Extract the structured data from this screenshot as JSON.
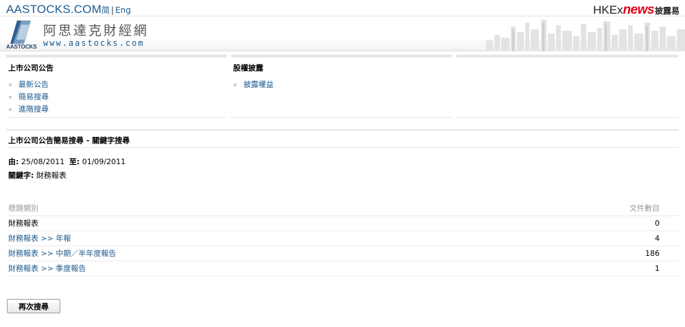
{
  "header": {
    "site_title": "AASTOCKS.COM",
    "lang_simplified": "简",
    "lang_separator": "|",
    "lang_english": "Eng",
    "hkex_part1": "HKEx",
    "hkex_part2": "news",
    "hkex_part3": "披露易"
  },
  "banner": {
    "logo_text": "AASTOCKS",
    "company_cn": "阿思達克財經網",
    "url": "www.aastocks.com"
  },
  "panels": {
    "announcements": {
      "title": "上市公司公告",
      "items": [
        "最新公告",
        "簡易搜尋",
        "進階搜尋"
      ]
    },
    "disclosure": {
      "title": "股權披露",
      "items": [
        "披露權益"
      ]
    }
  },
  "search": {
    "title": "上市公司公告簡易搜尋 - 關鍵字搜尋",
    "from_label": "由:",
    "from_date": "25/08/2011",
    "to_label": "至:",
    "to_date": "01/09/2011",
    "keyword_label": "關鍵字:",
    "keyword": "財務報表"
  },
  "results": {
    "columns": [
      "標題類別",
      "文件數目"
    ],
    "rows": [
      {
        "category": "財務報表",
        "count": "0",
        "is_link": false
      },
      {
        "category": "財務報表 >> 年報",
        "count": "4",
        "is_link": true
      },
      {
        "category": "財務報表 >> 中期／半年度報告",
        "count": "186",
        "is_link": true
      },
      {
        "category": "財務報表 >> 季度報告",
        "count": "1",
        "is_link": true
      }
    ]
  },
  "actions": {
    "search_again": "再次搜尋"
  },
  "colors": {
    "link": "#1d5a8f",
    "hkex_news_red": "#e2001a",
    "divider": "#e6e6e6"
  }
}
